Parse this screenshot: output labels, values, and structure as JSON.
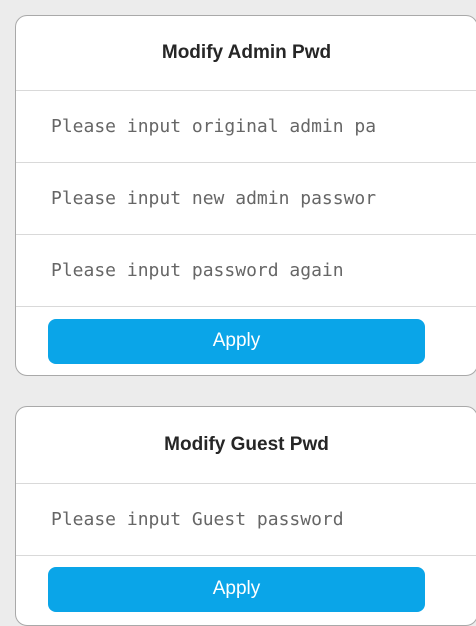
{
  "admin": {
    "title": "Modify Admin Pwd",
    "original_placeholder": "Please input original admin pa",
    "new_placeholder": "Please input new admin passwor",
    "again_placeholder": "Please input password again",
    "apply_label": "Apply"
  },
  "guest": {
    "title": "Modify Guest Pwd",
    "password_placeholder": "Please input Guest password",
    "apply_label": "Apply"
  },
  "colors": {
    "accent": "#0aa5e8",
    "background": "#ececec",
    "card": "#ffffff"
  }
}
